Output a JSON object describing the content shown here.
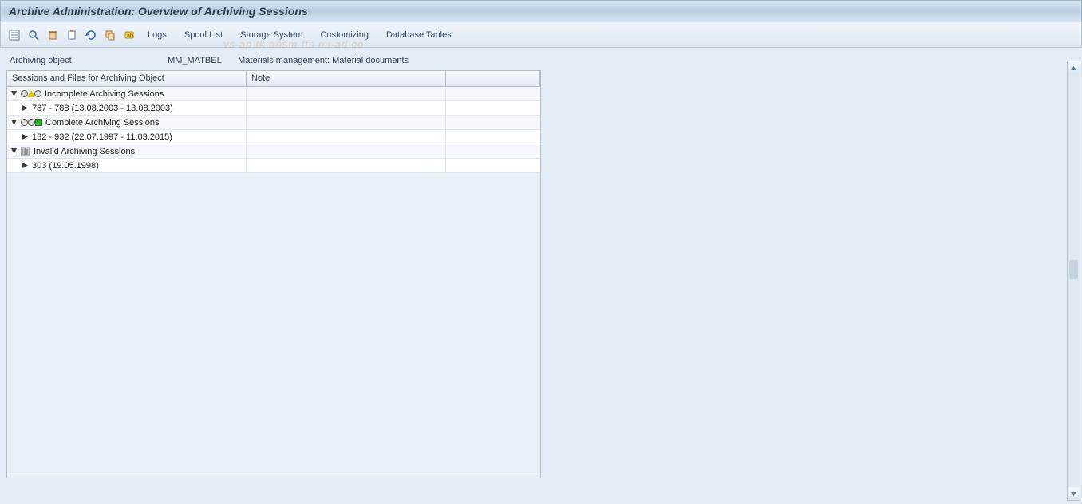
{
  "title": "Archive Administration: Overview of Archiving Sessions",
  "toolbar": {
    "icons": [
      "list-icon",
      "inspect-icon",
      "delete-icon",
      "clipboard-icon",
      "refresh-icon",
      "copy-icon",
      "highlight-icon"
    ],
    "text_buttons": [
      "Logs",
      "Spool List",
      "Storage System",
      "Customizing",
      "Database Tables"
    ]
  },
  "archiving_object": {
    "label": "Archiving object",
    "code": "MM_MATBEL",
    "desc": "Materials management: Material documents"
  },
  "table": {
    "headers": {
      "sessions": "Sessions and Files for Archiving Object",
      "note": "Note"
    },
    "rows": [
      {
        "level": 0,
        "expander": "open",
        "status": "incomplete",
        "text": "Incomplete Archiving Sessions"
      },
      {
        "level": 1,
        "expander": "closed",
        "text": "787 - 788 (13.08.2003 - 13.08.2003)"
      },
      {
        "level": 0,
        "expander": "open",
        "status": "complete",
        "text": "Complete Archiving Sessions"
      },
      {
        "level": 1,
        "expander": "closed",
        "text": "132 - 932 (22.07.1997 - 11.03.2015)"
      },
      {
        "level": 0,
        "expander": "open",
        "status": "invalid",
        "text": "Invalid Archiving Sessions"
      },
      {
        "level": 1,
        "expander": "closed",
        "text": "303 (19.05.1998)"
      }
    ]
  },
  "watermark": "vs ap tk ansm fts       mi ad    co"
}
